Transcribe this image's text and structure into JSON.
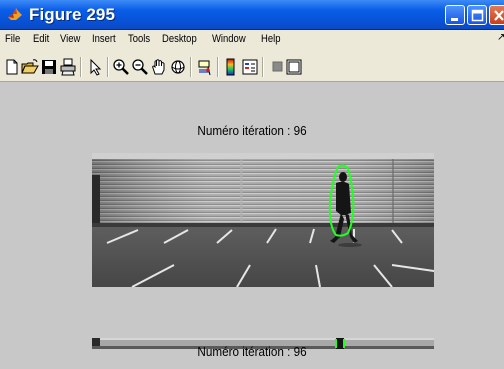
{
  "window": {
    "title": "Figure 295",
    "icon": "matlab-icon",
    "buttons": [
      "minimize-icon",
      "maximize-icon",
      "close-icon"
    ]
  },
  "menu": {
    "items": [
      {
        "label": "File"
      },
      {
        "label": "Edit"
      },
      {
        "label": "View"
      },
      {
        "label": "Insert"
      },
      {
        "label": "Tools"
      },
      {
        "label": "Desktop"
      },
      {
        "label": "Window"
      },
      {
        "label": "Help"
      }
    ],
    "overflow": "↗"
  },
  "toolbar": {
    "buttons": [
      "new-figure-icon",
      "open-file-icon",
      "save-figure-icon",
      "print-figure-icon",
      "edit-plot-arrow-icon",
      "zoom-in-icon",
      "zoom-out-icon",
      "pan-icon",
      "rotate-3d-icon",
      "data-cursor-icon",
      "insert-colorbar-icon",
      "insert-legend-icon",
      "hide-plot-tools-icon",
      "show-plot-tools-icon"
    ]
  },
  "axes": [
    {
      "title": "Numéro itération :  96",
      "content": "grayscale video frame of a parking lot with a walking person outlined in green contour"
    },
    {
      "title": "Numéro itération :  96",
      "content": "second axes, partially visible strip image"
    }
  ],
  "colors": {
    "titlebar": "#0a5ee8",
    "menu_background": "#ece9d8",
    "figure_background": "#c8c8c8",
    "contour": "#22ff22"
  }
}
